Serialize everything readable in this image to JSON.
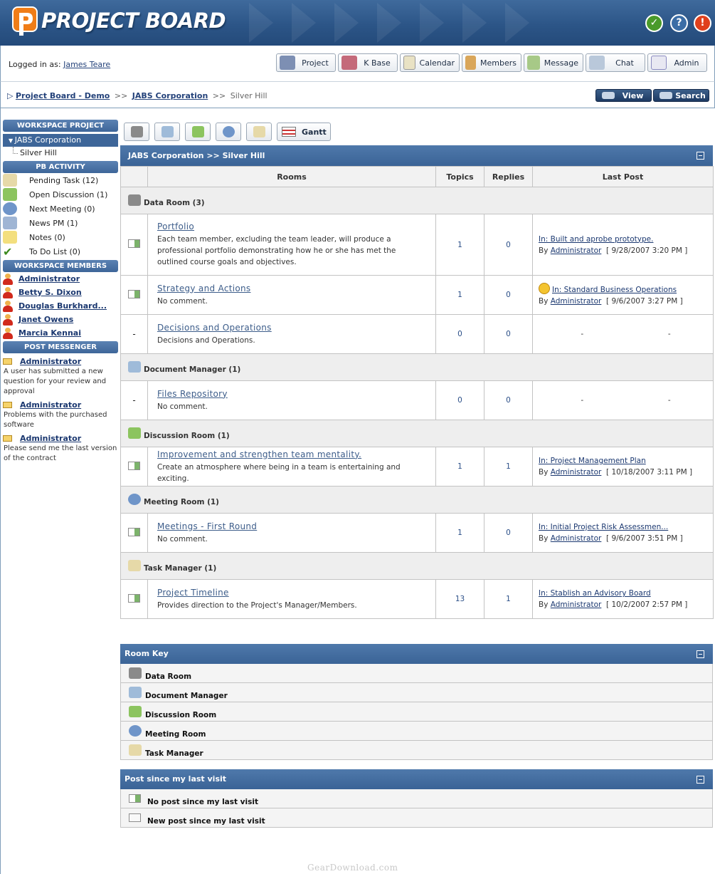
{
  "header": {
    "app_title": "PROJECT BOARD",
    "colors": {
      "header_bg": "#2c5587",
      "accent": "#3e6699"
    },
    "icons": [
      "wrench-icon",
      "help-icon",
      "power-icon"
    ]
  },
  "login": {
    "prefix": "Logged in as:",
    "user": "James Teare"
  },
  "nav": [
    {
      "label": "Project",
      "icon": "project-icon"
    },
    {
      "label": "K Base",
      "icon": "brain-icon"
    },
    {
      "label": "Calendar",
      "icon": "calendar-icon"
    },
    {
      "label": "Members",
      "icon": "members-icon"
    },
    {
      "label": "Message",
      "icon": "message-icon"
    },
    {
      "label": "Chat",
      "icon": "chat-icon"
    },
    {
      "label": "Admin",
      "icon": "admin-icon"
    }
  ],
  "breadcrumb": {
    "items": [
      "Project Board - Demo",
      "JABS Corporation"
    ],
    "current": "Silver Hill",
    "sep": ">>"
  },
  "view_button": "View",
  "search_button": "Search",
  "sidebar": {
    "workspace_heading": "WORKSPACE PROJECT",
    "workspace_selected": "JABS Corporation",
    "workspace_sub": "Silver Hill",
    "activity_heading": "PB ACTIVITY",
    "activity": [
      {
        "label": "Pending Task (12)",
        "icon": "pending-task-icon"
      },
      {
        "label": "Open Discussion (1)",
        "icon": "discussion-icon"
      },
      {
        "label": "Next Meeting (0)",
        "icon": "meeting-icon"
      },
      {
        "label": "News PM (1)",
        "icon": "news-pm-icon"
      },
      {
        "label": "Notes (0)",
        "icon": "notes-icon"
      },
      {
        "label": "To Do List (0)",
        "icon": "checkmark-icon"
      }
    ],
    "members_heading": "WORKSPACE MEMBERS",
    "members": [
      "Administrator",
      "Betty S. Dixon",
      "Douglas Burkhard...",
      "Janet Owens",
      "Marcia Kennai"
    ],
    "messenger_heading": "POST MESSENGER",
    "messages": [
      {
        "from": "Administrator",
        "text": "A user has submitted a new question for your review and approval"
      },
      {
        "from": "Administrator",
        "text": "Problems with the purchased software"
      },
      {
        "from": "Administrator",
        "text": "Please send me the last version of the contract"
      }
    ]
  },
  "toolbar": {
    "icons": [
      "data-room-tool-icon",
      "document-tool-icon",
      "discussion-tool-icon",
      "meeting-tool-icon",
      "task-tool-icon"
    ],
    "gantt_label": "Gantt"
  },
  "rooms_panel": {
    "title": "JABS Corporation >> Silver Hill",
    "columns": [
      "Rooms",
      "Topics",
      "Replies",
      "Last Post"
    ],
    "categories": [
      {
        "name": "Data Room (3)",
        "icon": "data-room-icon",
        "rooms": [
          {
            "marker": "room",
            "name": "Portfolio",
            "desc": "Each team member, excluding the team leader, will produce a professional portfolio demonstrating how he or she has met the outlined course goals and objectives.",
            "topics": "1",
            "replies": "0",
            "last_in": "In: Built and aprobe prototype.",
            "by": "By",
            "last_by": "Administrator",
            "last_date": "[ 9/28/2007 3:20 PM ]"
          },
          {
            "marker": "room",
            "name": "Strategy and Actions",
            "desc": "No comment.",
            "topics": "1",
            "replies": "0",
            "last_in": "In: Standard Business Operations",
            "by": "By",
            "last_by": "Administrator",
            "last_date": "[ 9/6/2007 3:27 PM ]",
            "last_icon": "smiley-icon"
          },
          {
            "marker": "-",
            "name": "Decisions and Operations",
            "desc": "Decisions and Operations.",
            "topics": "0",
            "replies": "0",
            "last_empty": [
              "-",
              "-"
            ]
          }
        ]
      },
      {
        "name": "Document Manager (1)",
        "icon": "document-manager-icon",
        "rooms": [
          {
            "marker": "-",
            "name": "Files Repository",
            "desc": "No comment.",
            "topics": "0",
            "replies": "0",
            "last_empty": [
              "-",
              "-"
            ]
          }
        ]
      },
      {
        "name": "Discussion Room (1)",
        "icon": "discussion-room-icon",
        "rooms": [
          {
            "marker": "room",
            "name": "Improvement and strengthen team mentality.",
            "desc": "Create an atmosphere where being in a team is entertaining and exciting.",
            "topics": "1",
            "replies": "1",
            "last_in": "In: Project Management Plan",
            "by": "By",
            "last_by": "Administrator",
            "last_date": "[ 10/18/2007 3:11 PM ]"
          }
        ]
      },
      {
        "name": "Meeting Room (1)",
        "icon": "meeting-room-icon",
        "rooms": [
          {
            "marker": "room",
            "name": "Meetings - First Round",
            "desc": "No comment.",
            "topics": "1",
            "replies": "0",
            "last_in": "In: Initial Project Risk Assessmen...",
            "by": "By",
            "last_by": "Administrator",
            "last_date": "[ 9/6/2007 3:51 PM ]"
          }
        ]
      },
      {
        "name": "Task Manager (1)",
        "icon": "task-manager-icon",
        "rooms": [
          {
            "marker": "room",
            "name": "Project Timeline",
            "desc": "Provides direction to the Project's Manager/Members.",
            "topics": "13",
            "replies": "1",
            "last_in": "In: Stablish an Advisory Board",
            "by": "By",
            "last_by": "Administrator",
            "last_date": "[ 10/2/2007 2:57 PM ]"
          }
        ]
      }
    ]
  },
  "room_key": {
    "title": "Room Key",
    "items": [
      "Data Room",
      "Document Manager",
      "Discussion Room",
      "Meeting Room",
      "Task Manager"
    ]
  },
  "posts_since": {
    "title": "Post since my last visit",
    "items": [
      "No post since my last visit",
      "New post since my last visit"
    ]
  },
  "watermark": "GearDownload.com"
}
